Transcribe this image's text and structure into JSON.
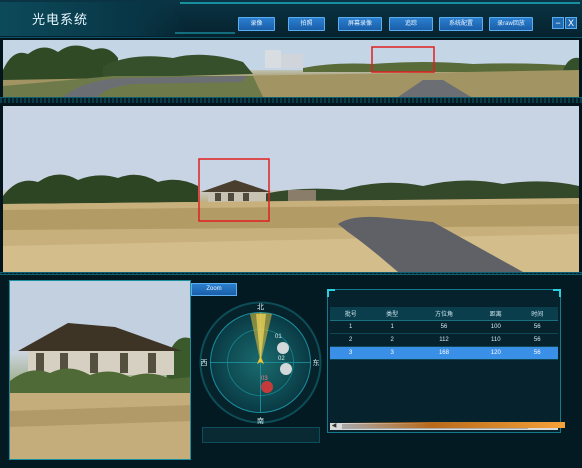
{
  "app": {
    "title": "光电系统"
  },
  "toolbar": {
    "buttons": [
      {
        "label": "录像"
      },
      {
        "label": "拍照"
      },
      {
        "label": "屏幕录像"
      },
      {
        "label": "追踪"
      },
      {
        "label": "系统配置"
      },
      {
        "label": "录raw回放"
      }
    ],
    "minimize_label": "−",
    "close_label": "X"
  },
  "bottom": {
    "zoom_label": "Zoom",
    "radar": {
      "north": "北",
      "south": "南",
      "east": "东",
      "west": "西",
      "targets": [
        {
          "label": "01",
          "color": "#e8e8e8"
        },
        {
          "label": "02",
          "color": "#e8e8e8"
        },
        {
          "label": "03",
          "color": "#d03a3a"
        }
      ]
    },
    "table": {
      "headers": [
        "批号",
        "类型",
        "方位角",
        "距离",
        "时间"
      ],
      "rows": [
        [
          "1",
          "1",
          "56",
          "100",
          "56"
        ],
        [
          "2",
          "2",
          "112",
          "110",
          "56"
        ],
        [
          "3",
          "3",
          "168",
          "120",
          "56"
        ]
      ],
      "selected_row": 3
    }
  },
  "colors": {
    "accent": "#1fb6c8",
    "button": "#1f6ab0",
    "selection": "#3a8fe6",
    "highlight_box": "#e02020"
  }
}
